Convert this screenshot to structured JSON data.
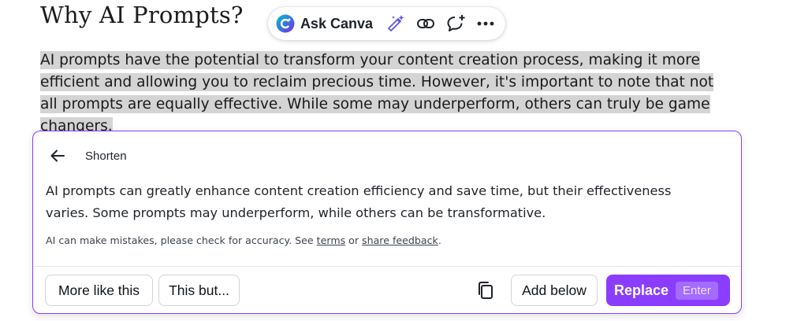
{
  "document": {
    "heading": "Why AI Prompts?",
    "paragraph_lines": [
      "AI prompts have the potential to transform your content creation process, making it more",
      "efficient and allowing you to reclaim precious time. However, it's important to note that not",
      "all prompts are equally effective. While some may underperform, others can truly be game",
      "changers."
    ],
    "selection_color": "#d4d4d4"
  },
  "toolbar": {
    "ask_label": "Ask Canva",
    "icons": [
      "canva-ai-logo-icon",
      "magic-pen-icon",
      "link-icon",
      "add-comment-icon",
      "more-options-icon"
    ]
  },
  "panel": {
    "title": "Shorten",
    "result_lines": [
      "AI prompts can greatly enhance content creation efficiency and save time, but their effectiveness",
      "varies. Some prompts may underperform, while others can be transformative."
    ],
    "disclaimer": {
      "prefix": "AI can make mistakes, please check for accuracy. See ",
      "terms_link": "terms",
      "middle": " or ",
      "feedback_link": "share feedback",
      "suffix": "."
    },
    "actions": {
      "more_like_this": "More like this",
      "this_but": "This but...",
      "add_below": "Add below",
      "replace": "Replace",
      "replace_shortcut": "Enter"
    },
    "accent_color": "#8b3dff"
  }
}
